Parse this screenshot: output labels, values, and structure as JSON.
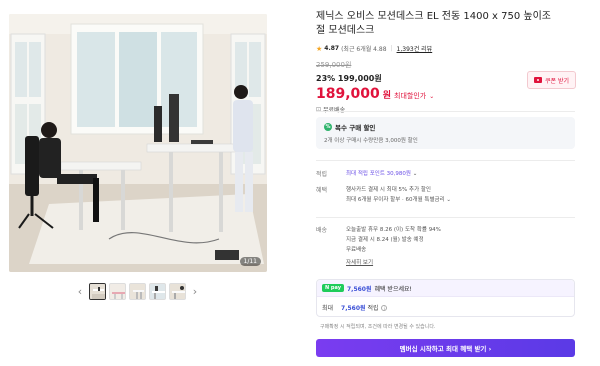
{
  "gallery": {
    "counter": "1/11",
    "prev_arrow": "‹",
    "next_arrow": "›",
    "thumbnail_count": 5
  },
  "product": {
    "title": "제닉스 오비스 모션데스크 EL 전동 1400 x 750 높이조절 모션데스크",
    "rating": "4.87",
    "rating_period": "(최근 6개월 4.88",
    "review_count": "1,393건 리뷰",
    "original_price": "259,000원",
    "discount_line": "23% 199,000원",
    "final_price": "189,000",
    "final_unit": "원",
    "final_tag": "최대할인가",
    "final_chevron": "⌄",
    "coupon_label": "쿠폰 받기",
    "shipping": "무료배송",
    "shipping_icon": "⊡"
  },
  "promo": {
    "icon": "%",
    "title": "복수 구매 할인",
    "desc": "2개 이상 구매시 수량만큼 3,000원 할인"
  },
  "points": {
    "label": "적립",
    "text": "최대 적립 포인트 30,980원",
    "chevron": "⌄"
  },
  "benefits": {
    "label": "혜택",
    "line1": "행사카드 결제 시 최대 5% 추가 할인",
    "line2": "최대 6개월 무이자 할부 · 60개월 특별금리",
    "chevron": "⌄"
  },
  "delivery": {
    "label": "배송",
    "line1": "오늘출발 휴무  8.26 (이) 도착 확률 94%",
    "line2": "지금 결제 시 8.24 (월) 발송 예정",
    "line3": "무료배송",
    "more": "자세히 보기"
  },
  "npay": {
    "badge": "N pay",
    "head_amount": "7,560원",
    "head_text": "혜택 받으세요!",
    "body_label": "최대",
    "body_amount": "7,560원",
    "body_suffix": "적립"
  },
  "notice": "구매확정 시 적립되며, 조건에 따라 변경될 수 있습니다.",
  "cta": "멤버십 시작하고 최대 혜택 받기  ›",
  "colors": {
    "accent_red": "#e0133c",
    "accent_blue": "#3a4fd6",
    "cta_purple": "#6a4ee6",
    "npay_green": "#1fcc5a"
  }
}
